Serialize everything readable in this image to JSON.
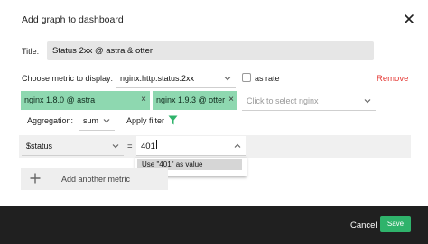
{
  "dialog": {
    "title": "Add graph to dashboard"
  },
  "form": {
    "title_label": "Title:",
    "title_value": "Status 2xx @ astra & otter",
    "metric_label": "Choose metric to display:",
    "metric_value": "nginx.http.status.2xx",
    "as_rate_label": "as rate",
    "as_rate_checked": false,
    "remove_label": "Remove",
    "tags": [
      {
        "label": "nginx 1.8.0 @ astra"
      },
      {
        "label": "nginx 1.9.3 @ otter"
      }
    ],
    "tag_select_placeholder": "Click to select nginx",
    "aggregation_label": "Aggregation:",
    "aggregation_value": "sum",
    "apply_filter_label": "Apply filter",
    "filter": {
      "field": "$status",
      "operator": "=",
      "value": "401",
      "suggestion": "Use \"401\" as value"
    },
    "add_metric_label": "Add another metric"
  },
  "footer": {
    "cancel_label": "Cancel",
    "save_label": "Save"
  },
  "colors": {
    "tag_bg": "#8ed8b0",
    "remove": "#e53935",
    "save_bg": "#2fb36b",
    "footer_bg": "#202020",
    "filter_icon": "#2fb36b"
  },
  "icons": [
    "close-icon",
    "chevron-down-icon",
    "chevron-up-icon",
    "tag-remove-icon",
    "filter-icon",
    "plus-icon"
  ]
}
